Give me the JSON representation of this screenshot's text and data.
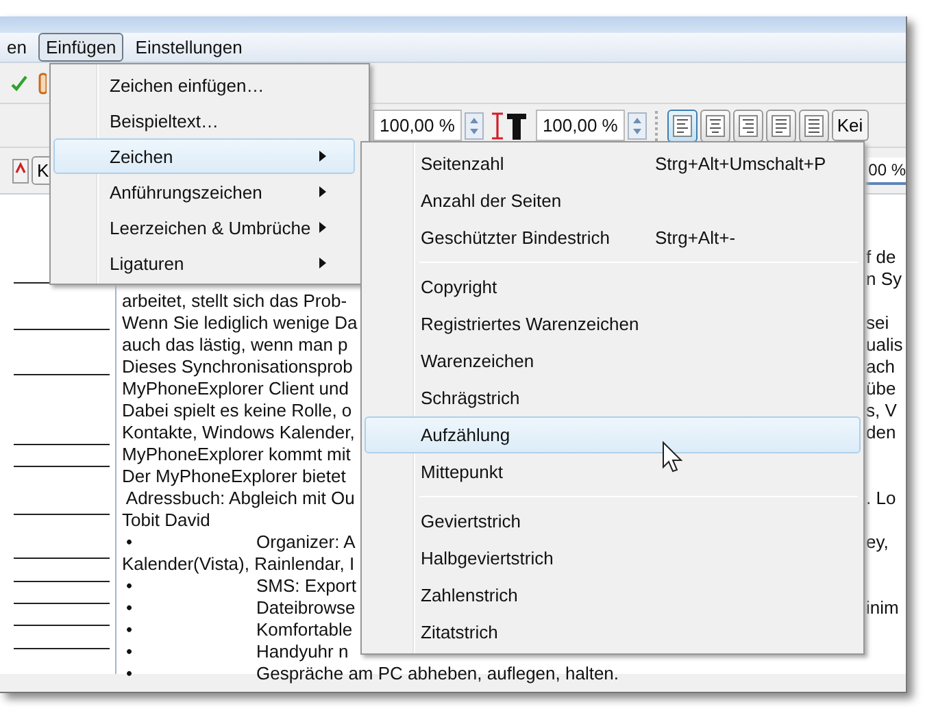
{
  "menubar": [
    {
      "label": "en",
      "selected": false
    },
    {
      "label": "Einfügen",
      "selected": true
    },
    {
      "label": "Einstellungen",
      "selected": false
    }
  ],
  "toolbar": {
    "spin_1": "100,00 %",
    "spin_2": "100,00 %",
    "alignment": [
      {
        "selected": true
      },
      {
        "selected": false
      },
      {
        "selected": false
      },
      {
        "selected": false
      },
      {
        "selected": false
      }
    ],
    "cut_button": "Kei",
    "small_button": "K",
    "zoom_value": "00 %"
  },
  "insert_menu": {
    "items": [
      {
        "label": "Zeichen einfügen…",
        "submenu": false,
        "selected": false
      },
      {
        "label": "Beispieltext…",
        "submenu": false,
        "selected": false
      },
      {
        "label": "Zeichen",
        "submenu": true,
        "selected": true
      },
      {
        "label": "Anführungszeichen",
        "submenu": true,
        "selected": false
      },
      {
        "label": "Leerzeichen & Umbrüche",
        "submenu": true,
        "selected": false
      },
      {
        "label": "Ligaturen",
        "submenu": true,
        "selected": false
      }
    ]
  },
  "char_submenu": {
    "items": [
      {
        "kind": "item",
        "label": "Seitenzahl",
        "shortcut": "Strg+Alt+Umschalt+P",
        "selected": false
      },
      {
        "kind": "item",
        "label": "Anzahl der Seiten",
        "selected": false
      },
      {
        "kind": "item",
        "label": "Geschützter Bindestrich",
        "shortcut": "Strg+Alt+-",
        "selected": false
      },
      {
        "kind": "separator"
      },
      {
        "kind": "item",
        "label": "Copyright",
        "selected": false
      },
      {
        "kind": "item",
        "label": "Registriertes Warenzeichen",
        "selected": false
      },
      {
        "kind": "item",
        "label": "Warenzeichen",
        "selected": false
      },
      {
        "kind": "item",
        "label": "Schrägstrich",
        "selected": false
      },
      {
        "kind": "item",
        "label": "Aufzählung",
        "selected": true
      },
      {
        "kind": "item",
        "label": "Mittepunkt",
        "selected": false
      },
      {
        "kind": "separator"
      },
      {
        "kind": "item",
        "label": "Geviertstrich",
        "selected": false
      },
      {
        "kind": "item",
        "label": "Halbgeviertstrich",
        "selected": false
      },
      {
        "kind": "item",
        "label": "Zahlenstrich",
        "selected": false
      },
      {
        "kind": "item",
        "label": "Zitatstrich",
        "selected": false
      }
    ]
  },
  "document": {
    "lines": [
      {
        "right": "f de"
      },
      {
        "right": "n Sy"
      },
      {
        "left": "arbeitet, stellt sich das Prob-"
      },
      {
        "left": "Wenn Sie lediglich wenige Da",
        "right": "sei"
      },
      {
        "left": "auch das lästig, wenn man p",
        "right": "ualis"
      },
      {
        "left": "Dieses Synchronisationsprob",
        "right": "ach"
      },
      {
        "left": "MyPhoneExplorer Client und",
        "right": "übe"
      },
      {
        "left": "Dabei spielt es keine Rolle, o",
        "right": "s, V"
      },
      {
        "left": "Kontakte, Windows Kalender,",
        "right": "den"
      },
      {
        "left": "MyPhoneExplorer kommt mit"
      },
      {
        "left": "Der MyPhoneExplorer bietet"
      },
      {
        "left": " Adressbuch: Abgleich mit Ou",
        "right": ". Lo"
      },
      {
        "left": "Tobit David"
      },
      {
        "bullet": "•",
        "left": "Organizer: A",
        "right": "ey,"
      },
      {
        "left": "Kalender(Vista), Rainlendar, I"
      },
      {
        "bullet": "•",
        "left": "SMS: Export"
      },
      {
        "bullet": "•",
        "left": "Dateibrowse",
        "right": "inim"
      },
      {
        "bullet": "•",
        "left": "Komfortable"
      },
      {
        "bullet": "•",
        "left": "Handyuhr n"
      },
      {
        "bullet": "•",
        "left": "Gespräche am PC abheben, auflegen, halten."
      }
    ]
  }
}
